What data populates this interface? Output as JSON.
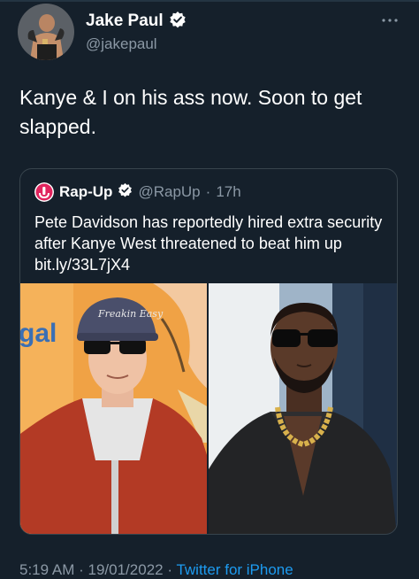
{
  "author": {
    "display_name": "Jake Paul",
    "handle": "@jakepaul",
    "verified": true
  },
  "tweet": {
    "text": "Kanye & I on his ass now. Soon to get slapped."
  },
  "quoted_tweet": {
    "display_name": "Rap-Up",
    "handle": "@RapUp",
    "separator": "·",
    "time": "17h",
    "verified": true,
    "text": "Pete Davidson has reportedly hired extra security after Kanye West threatened to beat him up ",
    "link": "bit.ly/33L7jX4",
    "cap_text": "Freakin Easy",
    "background_text": "gal"
  },
  "footer": {
    "time": "5:19 AM",
    "dot1": "·",
    "date": "19/01/2022",
    "dot2": "·",
    "source": "Twitter for iPhone"
  },
  "colors": {
    "background": "#15202b",
    "secondary_text": "#8b98a5",
    "accent": "#1d9bf0",
    "verified_badge": "#ffffff",
    "border": "#38444d"
  },
  "icons": {
    "more": "more-horizontal-icon",
    "verified": "verified-badge-icon"
  }
}
